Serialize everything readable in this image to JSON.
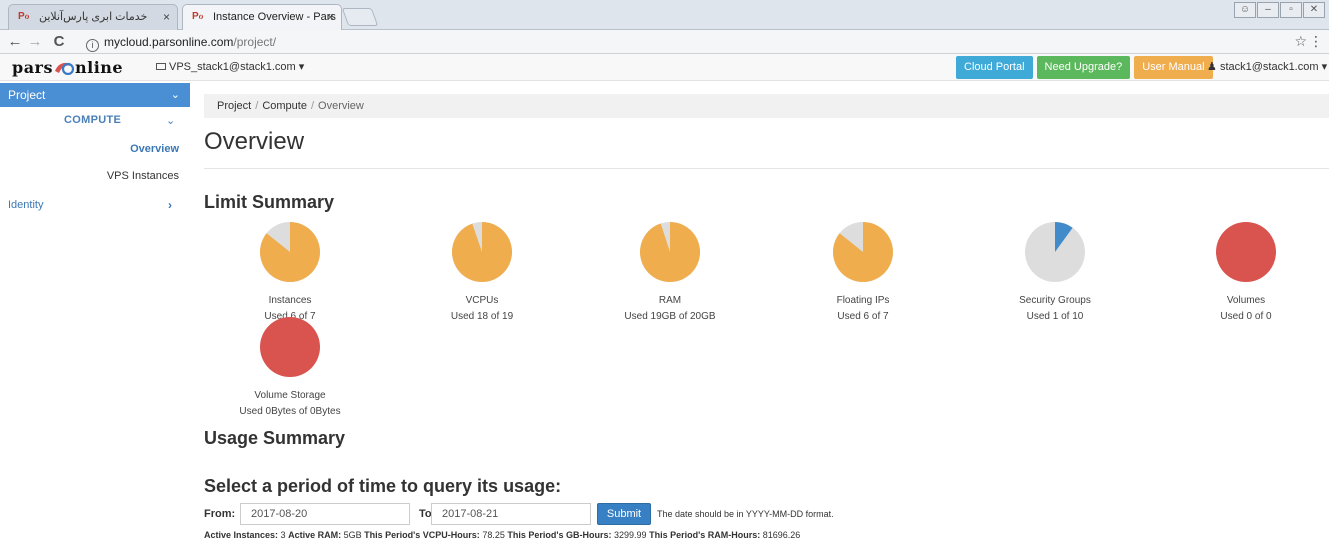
{
  "browser": {
    "tabs": [
      {
        "title": "خدمات ابری پارس‌آنلاین",
        "close": "×",
        "active": false
      },
      {
        "title": "Instance Overview - Pars",
        "close": "×",
        "active": true
      }
    ],
    "url_host": "mycloud.parsonline.com",
    "url_path": "/project/",
    "star_icon": "☆",
    "menu_icon": "⋮"
  },
  "navbar": {
    "logo_left": "pars",
    "logo_right": "nline",
    "project_selector": "VPS_stack1@stack1.com ▾",
    "buttons": [
      {
        "label": "Cloud Portal",
        "color": "#3fa9d8"
      },
      {
        "label": "Need Upgrade?",
        "color": "#5cb85c"
      },
      {
        "label": "User Manual",
        "color": "#f0ad4e"
      }
    ],
    "user_menu": "stack1@stack1.com ▾"
  },
  "sidebar": {
    "project": "Project",
    "compute": "COMPUTE",
    "overview": "Overview",
    "vps_instances": "VPS Instances",
    "identity": "Identity"
  },
  "breadcrumb": [
    "Project",
    "Compute",
    "Overview"
  ],
  "page_title": "Overview",
  "limit_summary": {
    "title": "Limit Summary",
    "items": [
      {
        "label": "Instances",
        "used_text": "Used 6 of 7",
        "used": 6,
        "total": 7,
        "color": "#f0ad4e"
      },
      {
        "label": "VCPUs",
        "used_text": "Used 18 of 19",
        "used": 18,
        "total": 19,
        "color": "#f0ad4e"
      },
      {
        "label": "RAM",
        "used_text": "Used 19GB of 20GB",
        "used": 19,
        "total": 20,
        "color": "#f0ad4e"
      },
      {
        "label": "Floating IPs",
        "used_text": "Used 6 of 7",
        "used": 6,
        "total": 7,
        "color": "#f0ad4e"
      },
      {
        "label": "Security Groups",
        "used_text": "Used 1 of 10",
        "used": 1,
        "total": 10,
        "color": "#428bca"
      },
      {
        "label": "Volumes",
        "used_text": "Used 0 of 0",
        "used": 0,
        "total": 0,
        "color": "#d9534f"
      },
      {
        "label": "Volume Storage",
        "used_text": "Used 0Bytes of 0Bytes",
        "used": 0,
        "total": 0,
        "color": "#d9534f"
      }
    ]
  },
  "usage_summary": {
    "title": "Usage Summary",
    "period_title": "Select a period of time to query its usage:",
    "from_label": "From:",
    "from_value": "2017-08-20",
    "to_label": "To:",
    "to_value": "2017-08-21",
    "submit_label": "Submit",
    "hint": "The date should be in YYYY-MM-DD format.",
    "stats": [
      {
        "label": "Active Instances:",
        "value": "3"
      },
      {
        "label": "Active RAM:",
        "value": "5GB"
      },
      {
        "label": "This Period's VCPU-Hours:",
        "value": "78.25"
      },
      {
        "label": "This Period's GB-Hours:",
        "value": "3299.99"
      },
      {
        "label": "This Period's RAM-Hours:",
        "value": "81696.26"
      }
    ]
  }
}
